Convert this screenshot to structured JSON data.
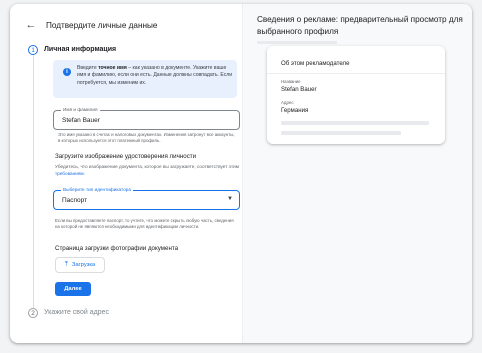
{
  "header": {
    "back_icon": "arrow-back-icon",
    "title": "Подтвердите личные данные"
  },
  "steps": [
    {
      "number": "1",
      "label": "Личная информация",
      "state": "active"
    },
    {
      "number": "2",
      "label": "Укажите свой адрес",
      "state": "inactive"
    }
  ],
  "info_box": {
    "icon": "info-icon",
    "text_prefix": "Введите ",
    "text_bold": "точное имя",
    "text_suffix": " – как указано в документе. Укажите ваше имя и фамилию, если они есть. Данные должны совпадать. Если потребуется, мы изменим их."
  },
  "name_field": {
    "label": "Имя и фамилия",
    "value": "Stefan Bauer",
    "help": "Это имя указано в счетах и налоговых документах. Изменения затронут все аккаунты, в которых используется этот платежный профиль."
  },
  "id_section": {
    "title": "Загрузите изображение удостоверения личности",
    "desc_prefix": "Убедитесь, что изображение документа, которое вы загружаете, соответствует этим ",
    "desc_link": "требованиям.",
    "doc_select_label": "Выберите тип идентификатора",
    "doc_select_value": "Паспорт",
    "help": "Если вы предоставляете паспорт, то учтите, что можете скрыть любую часть, сведения на которой не являются необходимыми для идентификации личности."
  },
  "upload_section": {
    "title": "Страница загрузки фотографии документа",
    "button_label": "Загрузка",
    "button_icon": "upload-icon"
  },
  "next_button": "Далее",
  "preview": {
    "title": "Сведения о рекламе: предварительный просмотр для выбранного профиля",
    "card_title": "Об этом рекламодателе",
    "name_label": "Название",
    "name_value": "Stefan Bauer",
    "address_label": "Адрес",
    "address_value": "Германия"
  },
  "colors": {
    "accent": "#1a73e8",
    "info_bg": "#e8f0fe",
    "placeholder": "#e8eaed"
  }
}
